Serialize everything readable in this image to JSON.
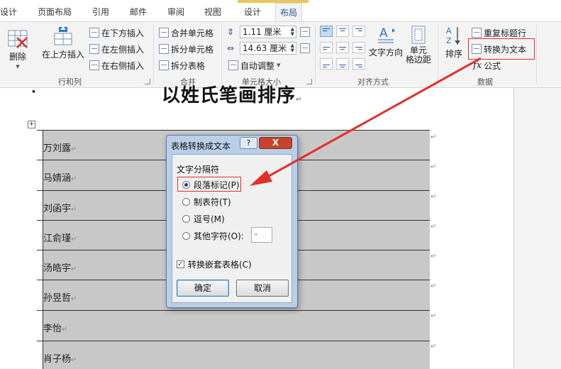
{
  "tabs": [
    {
      "label": "设计"
    },
    {
      "label": "页面布局"
    },
    {
      "label": "引用"
    },
    {
      "label": "邮件"
    },
    {
      "label": "审阅"
    },
    {
      "label": "视图"
    },
    {
      "label": "设计"
    },
    {
      "label": "布局"
    }
  ],
  "ribbon": {
    "rows_cols": {
      "group_label": "行和列",
      "delete_label": "删除",
      "insert_above_label": "在上方插入",
      "insert_below_label": "在下方插入",
      "insert_left_label": "在左侧插入",
      "insert_right_label": "在右侧插入"
    },
    "merge": {
      "group_label": "合并",
      "merge_cells_label": "合并单元格",
      "split_cells_label": "拆分单元格",
      "split_table_label": "拆分表格"
    },
    "cell_size": {
      "group_label": "单元格大小",
      "height_value": "1.11 厘米",
      "width_value": "14.63 厘米",
      "autofit_label": "自动调整"
    },
    "alignment": {
      "group_label": "对齐方式",
      "text_direction_label": "文字方向",
      "cell_margins_label": "单元\n格边距"
    },
    "data": {
      "group_label": "数据",
      "sort_label": "排序",
      "repeat_header_label": "重复标题行",
      "convert_to_text_label": "转换为文本",
      "formula_label": "公式"
    }
  },
  "document": {
    "heading": "以姓氏笔画排序",
    "names": [
      "万刘露",
      "马婧涵",
      "刘函宇",
      "江俞瑾",
      "汤皓宇",
      "孙昱哲",
      "李怡",
      "肖子杨"
    ]
  },
  "dialog": {
    "title": "表格转换成文本",
    "help_label": "?",
    "close_label": "X",
    "group_label": "文字分隔符",
    "options": [
      {
        "label": "段落标记(P)",
        "selected": true
      },
      {
        "label": "制表符(T)",
        "selected": false
      },
      {
        "label": "逗号(M)",
        "selected": false
      },
      {
        "label": "其他字符(O):",
        "selected": false
      }
    ],
    "other_char_value": "-",
    "nested_label": "转换嵌套表格(C)",
    "nested_checked": true,
    "ok_label": "确定",
    "cancel_label": "取消"
  },
  "colors": {
    "annotation_red": "#e0302a",
    "accent_blue": "#2b579a"
  }
}
